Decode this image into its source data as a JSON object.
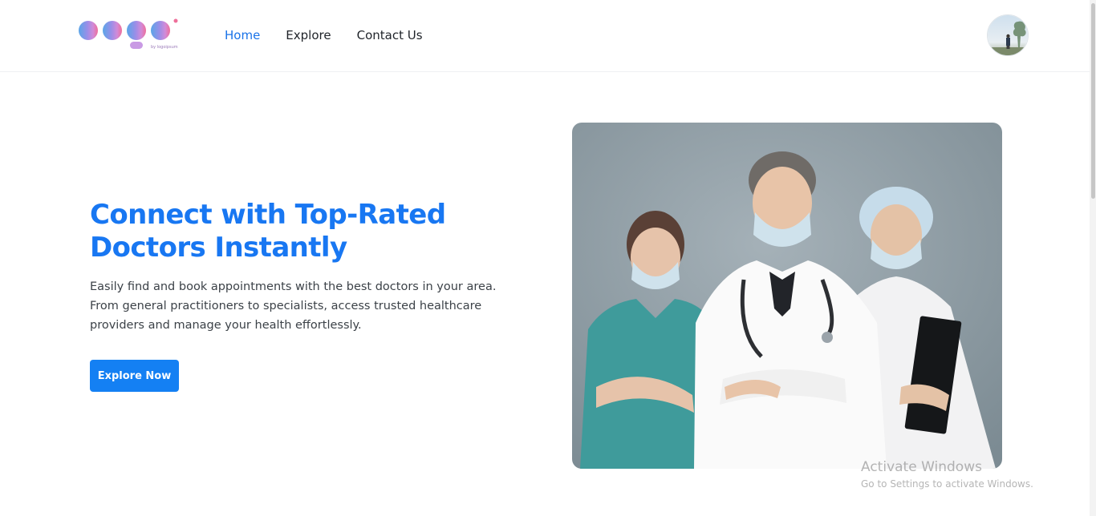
{
  "header": {
    "logo_text": "Logo",
    "logo_subtext": "by logoipsum",
    "nav": [
      {
        "label": "Home"
      },
      {
        "label": "Explore"
      },
      {
        "label": "Contact Us"
      }
    ],
    "active_nav": "Home"
  },
  "hero": {
    "title": "Connect with Top-Rated Doctors Instantly",
    "description": "Easily find and book appointments with the best doctors in your area. From general practitioners to specialists, access trusted healthcare providers and manage your health effortlessly.",
    "cta_label": "Explore Now"
  },
  "system": {
    "watermark_title": "Activate Windows",
    "watermark_sub": "Go to Settings to activate Windows."
  },
  "colors": {
    "accent": "#1877f2",
    "button": "#1480f3",
    "background": "#ffffff"
  }
}
